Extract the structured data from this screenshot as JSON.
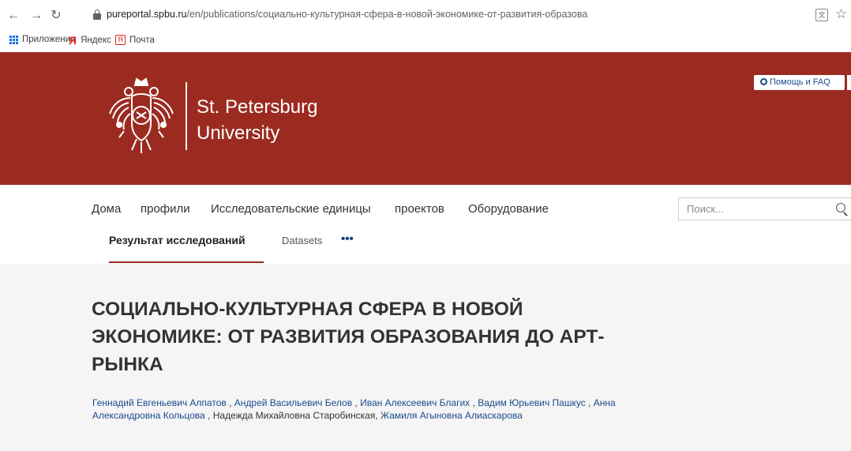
{
  "browser": {
    "url_host": "pureportal.spbu.ru",
    "url_path": "/en/publications/социально-культурная-сфера-в-новой-экономике-от-развития-образова"
  },
  "bookmarks": {
    "apps": "Приложения",
    "yandex": "Яндекс",
    "mail": "Почта"
  },
  "header": {
    "help_label": "Помощь и FAQ",
    "logo_line1": "St. Petersburg",
    "logo_line2": "University",
    "brand_color": "#9b2b21"
  },
  "nav": {
    "items": [
      "Дома",
      "профили",
      "Исследовательские единицы",
      "проектов",
      "Оборудование"
    ],
    "search_placeholder": "Поиск...",
    "sub_active": "Результат исследований",
    "sub_datasets": "Datasets",
    "more": "•••"
  },
  "publication": {
    "title": "СОЦИАЛЬНО-КУЛЬТУРНАЯ СФЕРА В НОВОЙ ЭКОНОМИКЕ: ОТ РАЗВИТИЯ ОБРАЗОВАНИЯ ДО АРТ-РЫНКА",
    "authors": [
      {
        "name": "Геннадий Евгеньевич Алпатов",
        "linked": true
      },
      {
        "name": "Андрей Васильевич Белов",
        "linked": true
      },
      {
        "name": "Иван Алексеевич Благих",
        "linked": true
      },
      {
        "name": "Вадим Юрьевич Пашкус",
        "linked": true
      },
      {
        "name": "Анна Александровна Кольцова",
        "linked": true
      },
      {
        "name": "Надежда Михайловна Старобинская,",
        "linked": false
      },
      {
        "name": "Жамиля Агыновна Алиаскарова",
        "linked": true
      }
    ]
  }
}
